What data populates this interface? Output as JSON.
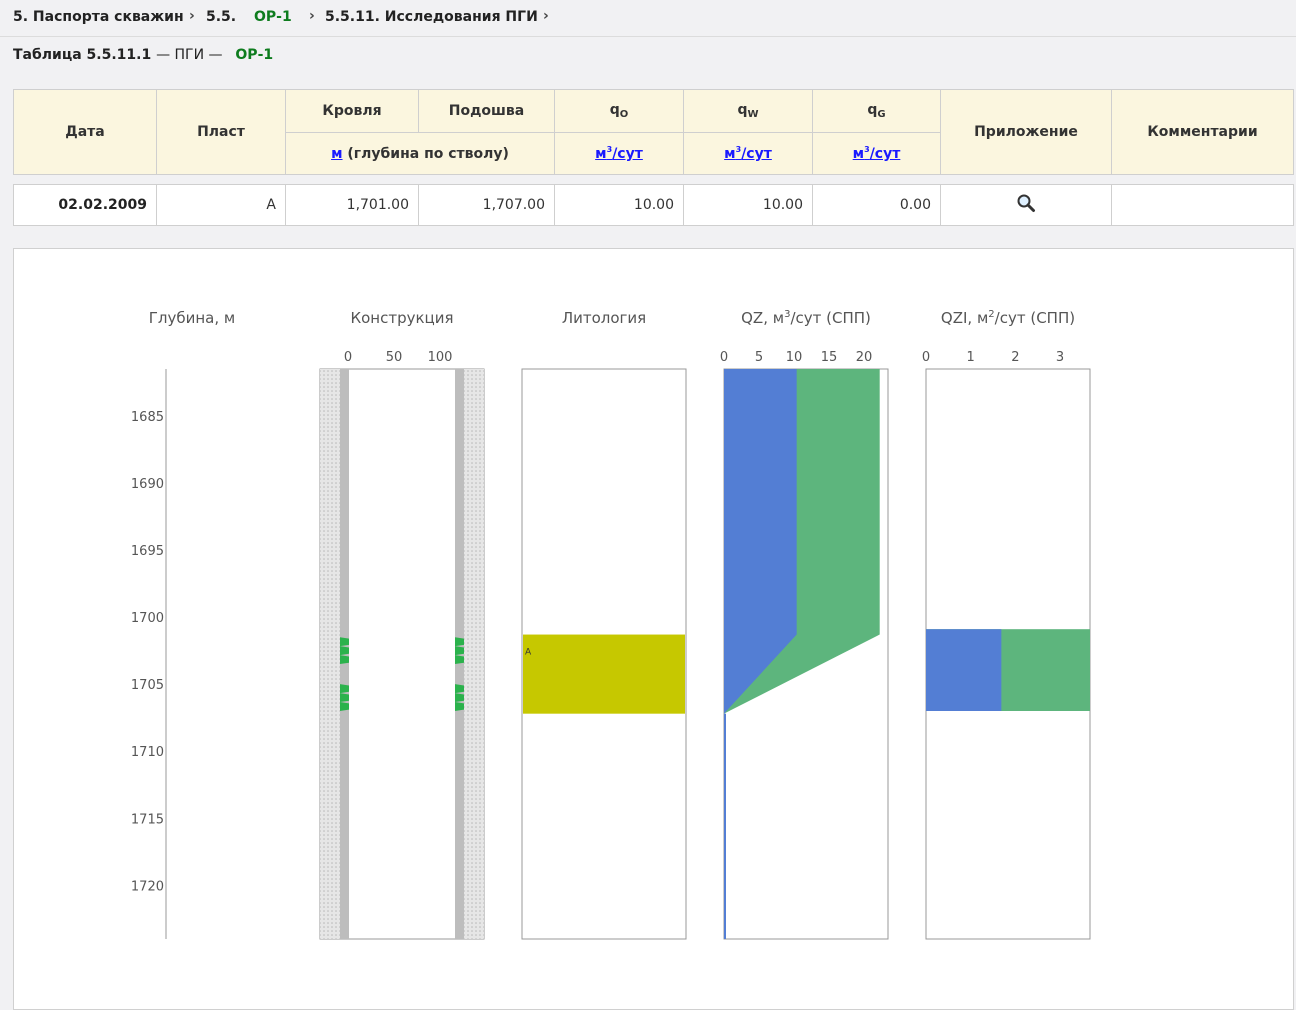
{
  "breadcrumb": {
    "item1": "5. Паспорта скважин",
    "item2": "5.5.",
    "item2_well": "ОР-1",
    "item3": "5.5.11. Исследования ПГИ",
    "separator": "›"
  },
  "subtitle": {
    "table_label": "Таблица 5.5.11.1",
    "dash1": "— ПГИ —",
    "well": "ОР-1"
  },
  "table": {
    "headers": {
      "date": "Дата",
      "layer": "Пласт",
      "top": "Кровля",
      "bottom": "Подошва",
      "depth_unit": "м",
      "depth_unit_note": " (глубина по стволу)",
      "q_letter": "q",
      "qo_sub": "O",
      "qw_sub": "W",
      "qg_sub": "G",
      "rate_unit_m": "м",
      "rate_unit_exp": "3",
      "rate_unit_rest": "/сут",
      "attachment": "Приложение",
      "comments": "Комментарии"
    },
    "rows": [
      {
        "date": "02.02.2009",
        "layer": "A",
        "top": "1,701.00",
        "bottom": "1,707.00",
        "qo": "10.00",
        "qw": "10.00",
        "qg": "0.00",
        "comment": ""
      }
    ]
  },
  "icons": {
    "attachment": "magnifier-icon"
  },
  "chart_titles": {
    "depth": "Глубина, м",
    "construction": "Конструкция",
    "lithology": "Литология",
    "qz": "QZ, м",
    "qz_exp": "3",
    "qz_rest": "/сут (СПП)",
    "qzi": "QZI, м",
    "qzi_exp": "2",
    "qzi_rest": "/сут (СПП)"
  },
  "chart_data": {
    "type": "area",
    "depth_axis": {
      "label": "Глубина, м",
      "ticks": [
        1685,
        1690,
        1695,
        1700,
        1705,
        1710,
        1715,
        1720
      ],
      "range": [
        1681.5,
        1724
      ]
    },
    "construction": {
      "ticks": [
        0,
        50,
        100
      ],
      "perforations": [
        {
          "from": 1701.5,
          "to": 1703.5
        },
        {
          "from": 1705,
          "to": 1707
        }
      ]
    },
    "lithology": {
      "intervals": [
        {
          "label": "A",
          "from": 1701.3,
          "to": 1707.2,
          "color": "#c6c800"
        }
      ]
    },
    "qz": {
      "ticks": [
        0,
        5,
        10,
        15,
        20
      ],
      "series": [
        {
          "color": "#537ed4",
          "points": [
            [
              1681.5,
              10.5
            ],
            [
              1701.3,
              10.5
            ],
            [
              1707.2,
              0
            ]
          ]
        },
        {
          "color": "#5db57d",
          "points": [
            [
              1681.5,
              22.5
            ],
            [
              1701.3,
              22.5
            ],
            [
              1707.2,
              0
            ]
          ]
        }
      ]
    },
    "qzi": {
      "ticks": [
        0,
        1,
        2,
        3
      ],
      "interval": {
        "from": 1700.9,
        "to": 1707.0
      },
      "series": [
        {
          "color": "#537ed4",
          "value": 1.7
        },
        {
          "color": "#5db57d",
          "value": 3.7
        }
      ]
    }
  }
}
